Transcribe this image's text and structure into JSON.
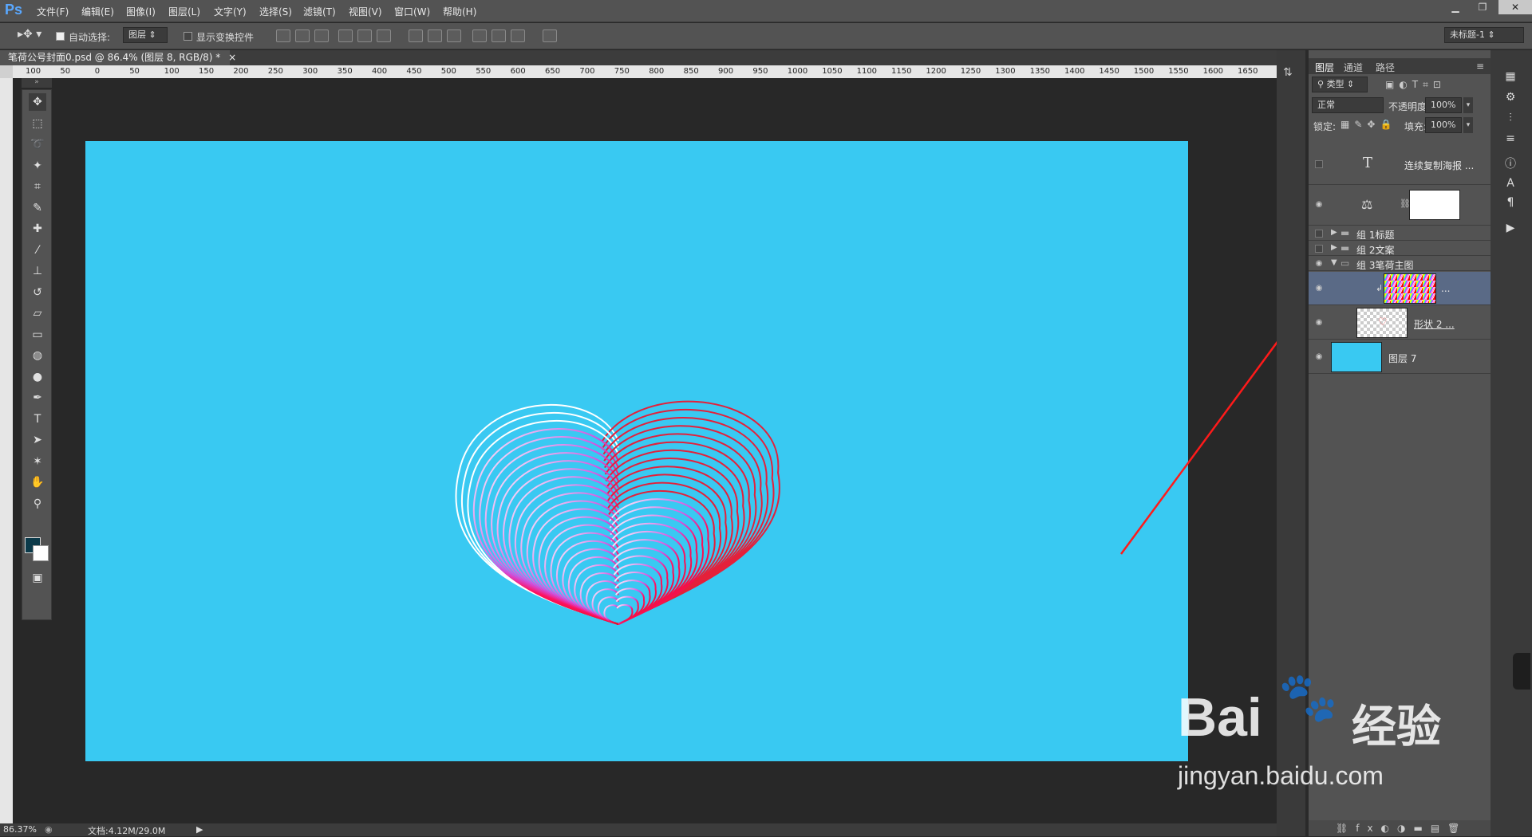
{
  "app": {
    "logo": "Ps"
  },
  "menu": [
    "文件(F)",
    "编辑(E)",
    "图像(I)",
    "图层(L)",
    "文字(Y)",
    "选择(S)",
    "滤镜(T)",
    "视图(V)",
    "窗口(W)",
    "帮助(H)"
  ],
  "window_controls": {
    "minimize": "▁",
    "restore": "❐",
    "close": "✕"
  },
  "options": {
    "auto_select_label": "自动选择:",
    "auto_select_value": "图层",
    "show_transform_label": "显示变换控件",
    "workspace_value": "未标题-1"
  },
  "document": {
    "tab_title": "笔荷公号封面0.psd @ 86.4% (图层 8, RGB/8) *",
    "tab_close": "×",
    "zoom": "86.37%",
    "doc_size": "文档:4.12M/29.0M"
  },
  "ruler_labels": [
    "100",
    "50",
    "0",
    "50",
    "100",
    "150",
    "200",
    "250",
    "300",
    "350",
    "400",
    "450",
    "500",
    "550",
    "600",
    "650",
    "700",
    "750",
    "800",
    "850",
    "900",
    "950",
    "1000",
    "1050",
    "1100",
    "1150",
    "1200",
    "1250",
    "1300",
    "1350",
    "1400",
    "1450",
    "1500",
    "1550",
    "1600",
    "1650"
  ],
  "tools": [
    {
      "name": "move-tool",
      "glyph": "✥"
    },
    {
      "name": "marquee-tool",
      "glyph": "⬚"
    },
    {
      "name": "lasso-tool",
      "glyph": "➰"
    },
    {
      "name": "magic-wand-tool",
      "glyph": "✦"
    },
    {
      "name": "crop-tool",
      "glyph": "⌗"
    },
    {
      "name": "eyedropper-tool",
      "glyph": "✎"
    },
    {
      "name": "healing-tool",
      "glyph": "✚"
    },
    {
      "name": "brush-tool",
      "glyph": "⁄"
    },
    {
      "name": "stamp-tool",
      "glyph": "⊥"
    },
    {
      "name": "history-brush-tool",
      "glyph": "↺"
    },
    {
      "name": "eraser-tool",
      "glyph": "▱"
    },
    {
      "name": "gradient-tool",
      "glyph": "▭"
    },
    {
      "name": "blur-tool",
      "glyph": "◍"
    },
    {
      "name": "dodge-tool",
      "glyph": "●"
    },
    {
      "name": "pen-tool",
      "glyph": "✒"
    },
    {
      "name": "type-tool",
      "glyph": "T"
    },
    {
      "name": "path-select-tool",
      "glyph": "➤"
    },
    {
      "name": "shape-tool",
      "glyph": "✶"
    },
    {
      "name": "hand-tool",
      "glyph": "✋"
    },
    {
      "name": "zoom-tool",
      "glyph": "⚲"
    },
    {
      "name": "quick-mask-tool",
      "glyph": "◎"
    },
    {
      "name": "screen-mode-tool",
      "glyph": "▣"
    }
  ],
  "colors": {
    "canvas": "#39c9f2",
    "foreground": "#0b3a4a",
    "background": "#ffffff",
    "selected_layer": "#5a6a86",
    "arrow": "#ff1a1a"
  },
  "layers_panel": {
    "tabs": [
      "图层",
      "通道",
      "路径"
    ],
    "filter_label": "类型",
    "blend_mode": "正常",
    "opacity_label": "不透明度:",
    "opacity_value": "100%",
    "lock_label": "锁定:",
    "fill_label": "填充:",
    "fill_value": "100%",
    "layers": [
      {
        "name": "连续复制海报 ...",
        "kind": "text",
        "visible": false
      },
      {
        "name": "",
        "kind": "adjustment",
        "visible": true
      },
      {
        "name": "组 1标题",
        "kind": "group",
        "visible": false
      },
      {
        "name": "组 2文案",
        "kind": "group",
        "visible": false
      },
      {
        "name": "组 3笔荷主图",
        "kind": "group-open",
        "visible": true
      },
      {
        "name": "...",
        "kind": "clipped",
        "visible": true,
        "selected": true
      },
      {
        "name": "形状 2 ...",
        "kind": "shape",
        "visible": true
      },
      {
        "name": "图层 7",
        "kind": "fill",
        "visible": true
      }
    ]
  },
  "watermark": {
    "brand": "Bai",
    "brand_cn": "经验",
    "url": "jingyan.baidu.com"
  }
}
